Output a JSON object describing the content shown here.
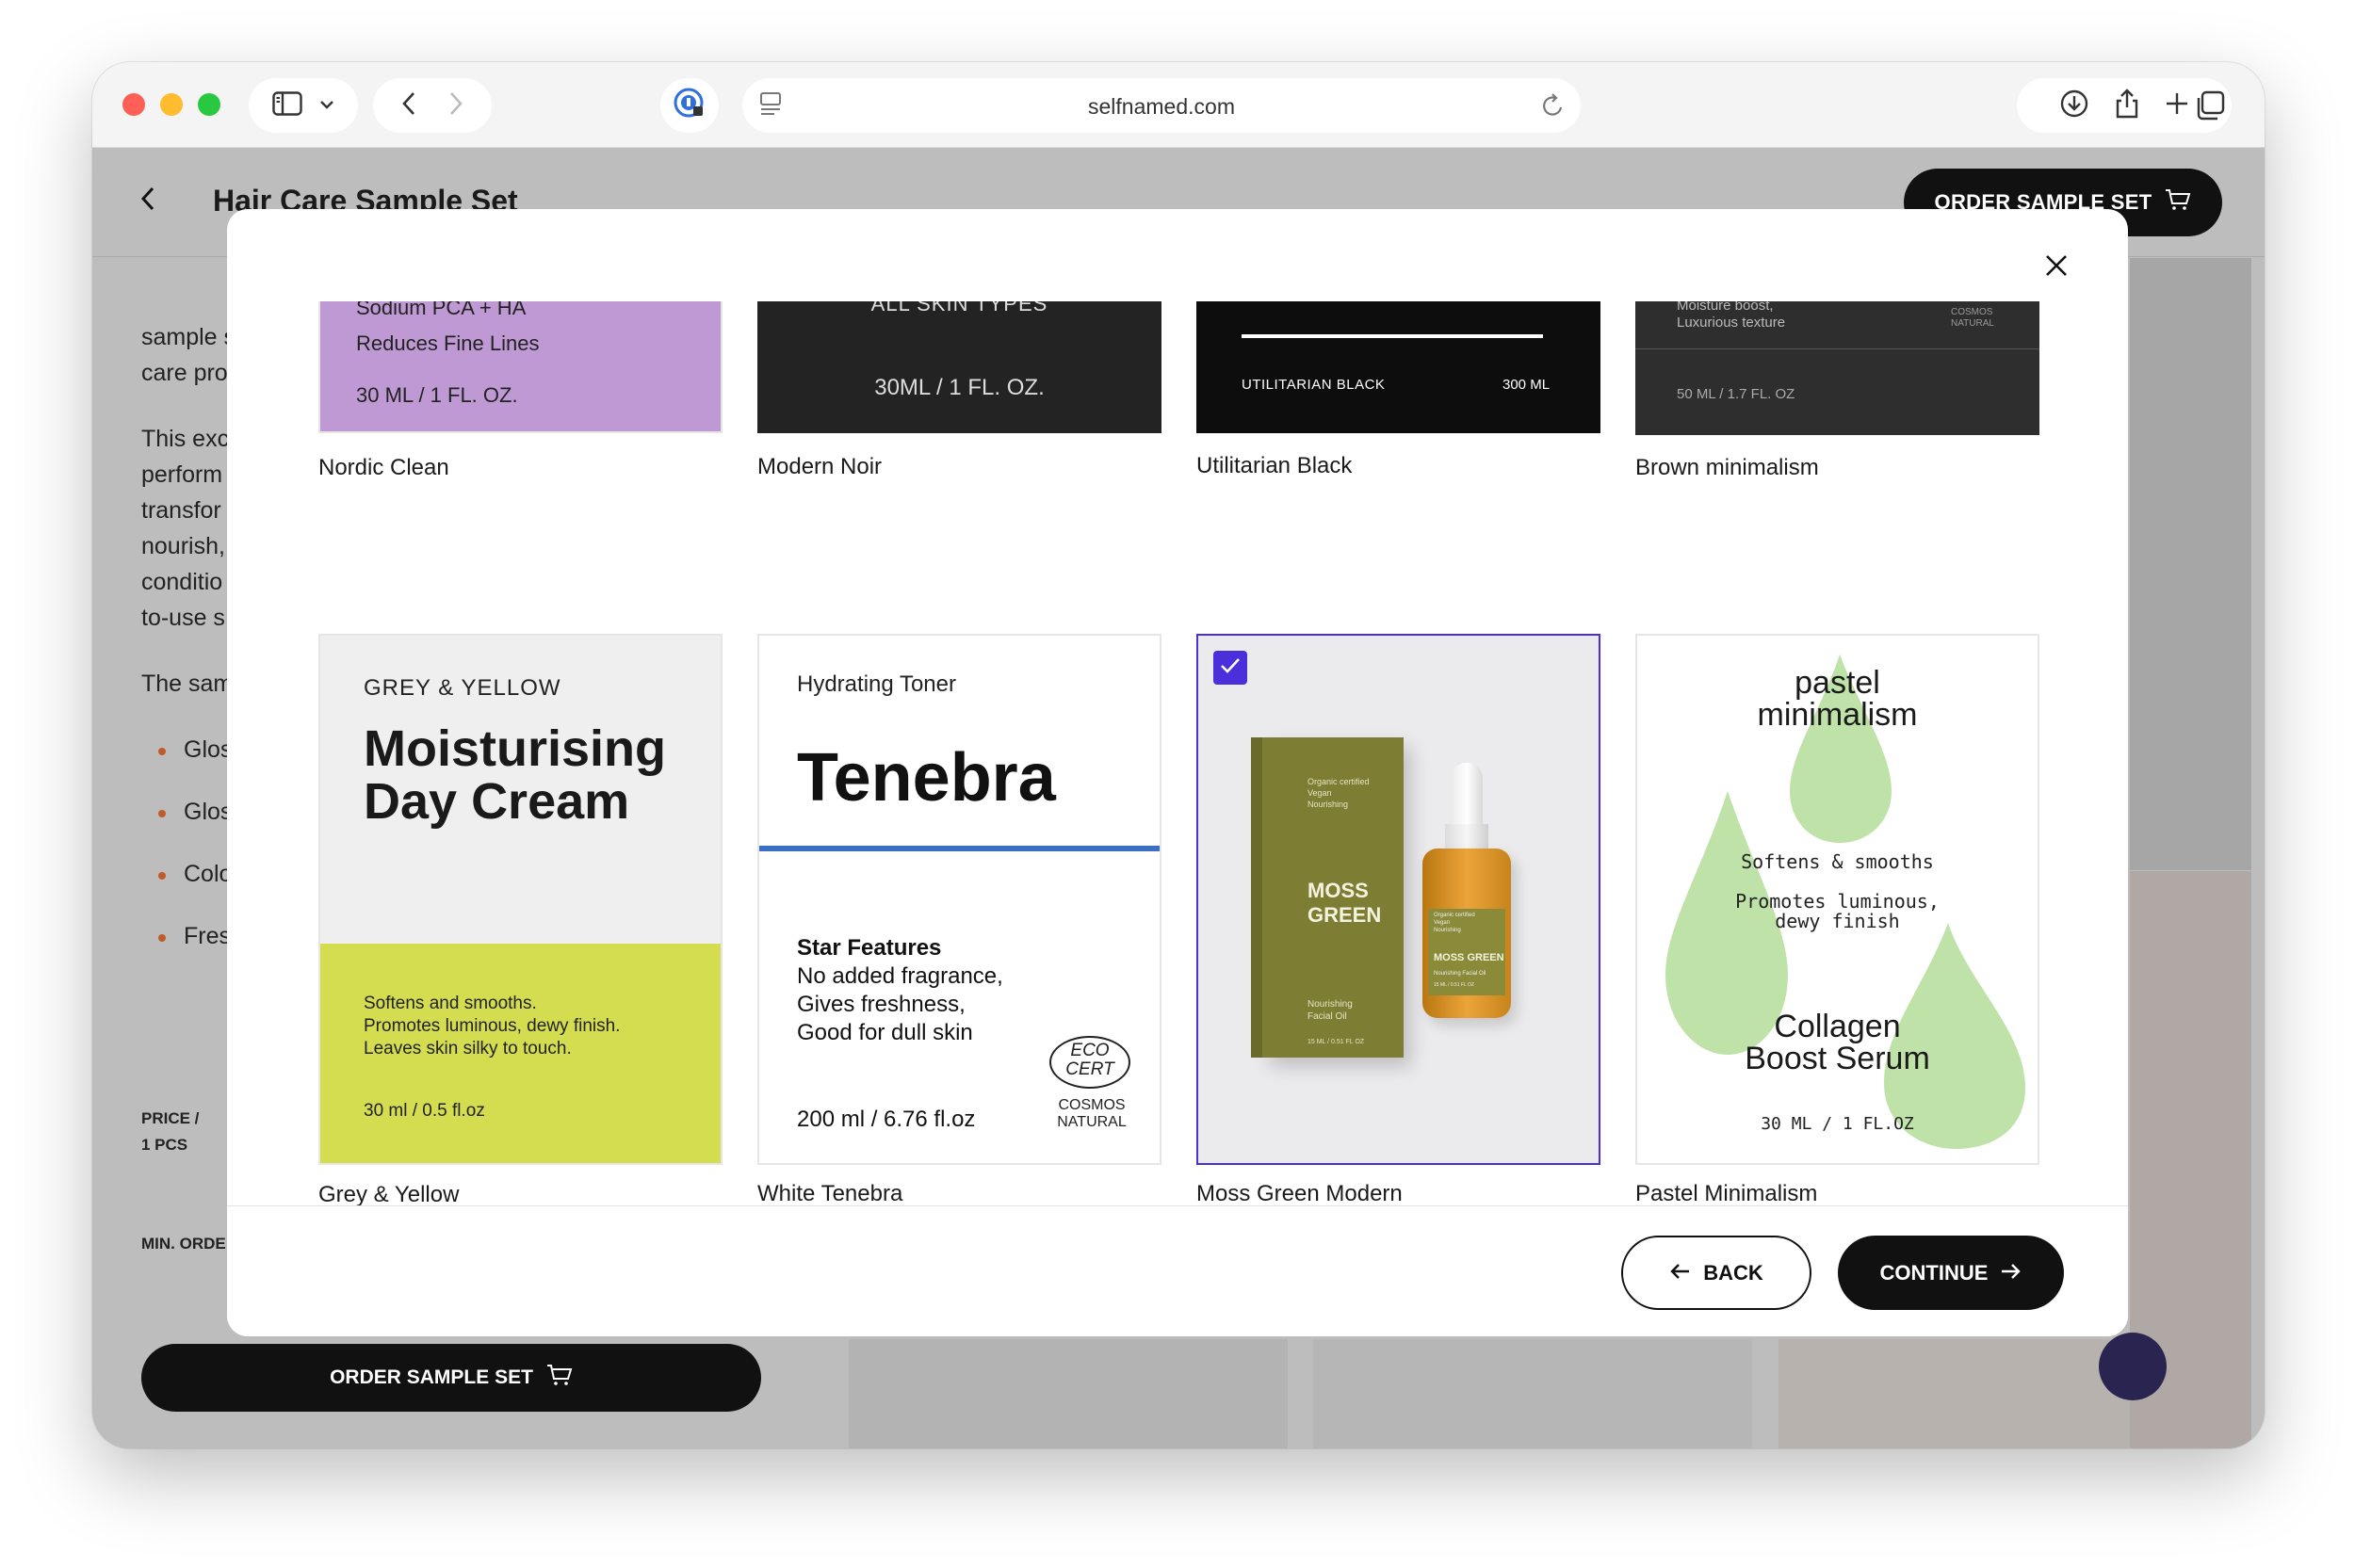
{
  "browser": {
    "url": "selfnamed.com"
  },
  "page": {
    "title": "Hair Care Sample Set",
    "order_button": "ORDER SAMPLE SET",
    "side_lines": [
      "sample s",
      "care pro",
      "This exc",
      "perform",
      "transfor",
      "nourish,",
      "conditio",
      "to-use s",
      "The sam"
    ],
    "bullets": [
      "Glos",
      "Glos",
      "Colo",
      "Fres"
    ],
    "price_label_1": "PRICE /",
    "price_label_2": "1 PCS",
    "min_order": "MIN. ORDE",
    "order_bottom": "ORDER SAMPLE SET"
  },
  "modal": {
    "back_label": "BACK",
    "continue_label": "CONTINUE",
    "cards_row1": [
      {
        "name": "Nordic Clean",
        "line1": "Sodium PCA + HA",
        "line2": "Reduces Fine Lines",
        "size": "30 ML / 1 FL. OZ."
      },
      {
        "name": "Modern Noir",
        "line1": "ALL SKIN TYPES",
        "size": "30ML / 1 FL. OZ."
      },
      {
        "name": "Utilitarian Black",
        "line1": "UTILITARIAN BLACK",
        "size": "300 ML"
      },
      {
        "name": "Brown minimalism",
        "line1": "Moisture boost,",
        "line2": "Luxurious texture",
        "brand1": "COSMOS",
        "brand2": "NATURAL",
        "size": "50 ML / 1.7 FL. OZ"
      }
    ],
    "cards_row2": [
      {
        "name": "Grey & Yellow",
        "kicker": "GREY & YELLOW",
        "title1": "Moisturising",
        "title2": "Day Cream",
        "body1": "Softens and smooths.",
        "body2": "Promotes luminous, dewy finish.",
        "body3": "Leaves skin silky to touch.",
        "size": "30 ml / 0.5 fl.oz"
      },
      {
        "name": "White Tenebra",
        "kicker": "Hydrating Toner",
        "title": "Tenebra",
        "feat_title": "Star Features",
        "feat1": "No added fragrance,",
        "feat2": "Gives freshness,",
        "feat3": "Good for dull skin",
        "size": "200 ml / 6.76 fl.oz",
        "eco1": "ECO",
        "eco2": "CERT",
        "eco3": "COSMOS",
        "eco4": "NATURAL"
      },
      {
        "name": "Moss Green Modern",
        "box1": "Organic certified",
        "box2": "Vegan",
        "box3": "Nourishing",
        "title1": "MOSS",
        "title2": "GREEN",
        "sub1": "Nourishing",
        "sub2": "Facial Oil",
        "vol": "15 ML / 0.51 FL OZ",
        "bottle1": "Organic certified",
        "bottle2": "Vegan",
        "bottle3": "Nourishing",
        "bottle4": "MOSS GREEN",
        "bottle5": "Nourishing Facial Oil",
        "bottle6": "15 ML / 0.51 FL OZ",
        "selected": true
      },
      {
        "name": "Pastel Minimalism",
        "title1": "pastel",
        "title2": "minimalism",
        "body1": "Softens & smooths",
        "body2": "Promotes luminous,",
        "body3": "dewy finish",
        "prod1": "Collagen",
        "prod2": "Boost Serum",
        "size": "30 ML / 1 FL.OZ"
      }
    ]
  },
  "colors": {
    "accent": "#4b2fdb",
    "purple_label": "#bf99d4",
    "lime": "#d4dd50",
    "pastel_green": "#bfe2a8",
    "tenebra_blue": "#3a6fc4",
    "moss": "#7d7d33"
  },
  "icons": {
    "sidebar": "sidebar-icon",
    "back": "chevron-left-icon",
    "forward": "chevron-right-icon",
    "reload": "reload-icon",
    "download": "download-icon",
    "share": "share-icon",
    "new_tab": "plus-icon",
    "tabs": "tabs-icon",
    "cart": "cart-icon",
    "close": "close-icon",
    "check": "check-icon"
  }
}
